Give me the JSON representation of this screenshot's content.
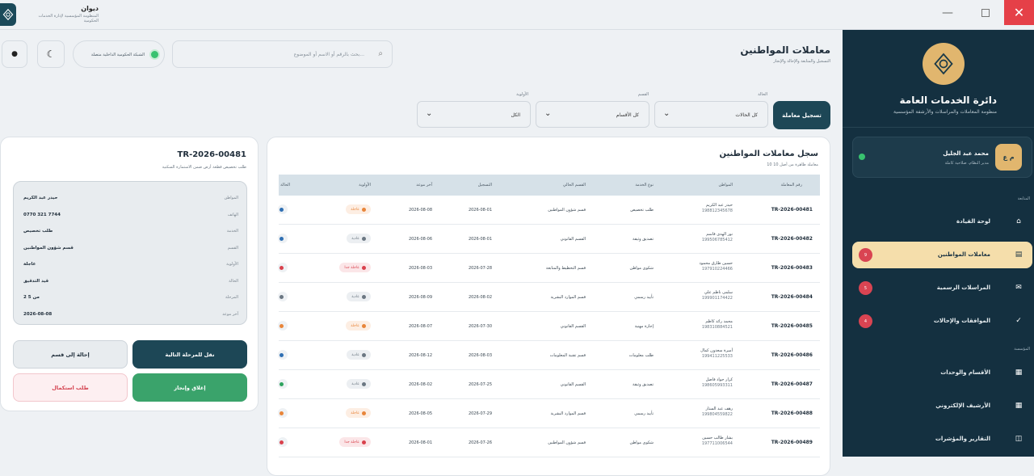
{
  "app": {
    "name": "ديوان",
    "subtitle": "المنظومة المؤسسية لإدارة الخدمات الحكومية"
  },
  "window": {
    "minimize": "—",
    "close": "✕"
  },
  "sidebar": {
    "org_title": "دائرة الخدمات العامة",
    "org_subtitle": "منظومة المعاملات والمراسلات والأرشفة المؤسسية",
    "user": {
      "initials": "م ع",
      "name": "محمد عبد الجليل",
      "role": "مدير النظام، صلاحية كاملة"
    },
    "section_main": "المتابعة",
    "section_admin": "المؤسسة",
    "items": [
      {
        "label": "لوحة القيادة",
        "icon": "home-icon",
        "glyph": "⌂"
      },
      {
        "label": "معاملات المواطنين",
        "icon": "list-icon",
        "glyph": "▤",
        "badge": "9",
        "active": true
      },
      {
        "label": "المراسلات الرسمية",
        "icon": "mail-icon",
        "glyph": "✉",
        "badge": "5"
      },
      {
        "label": "الموافقات والإحالات",
        "icon": "check-icon",
        "glyph": "✓",
        "badge": "4"
      },
      {
        "label": "الأقسام والوحدات",
        "icon": "grid-icon",
        "glyph": "▦"
      },
      {
        "label": "الأرشيف الإلكتروني",
        "icon": "archive-icon",
        "glyph": "▦"
      },
      {
        "label": "التقارير والمؤشرات",
        "icon": "report-icon",
        "glyph": "◫"
      }
    ]
  },
  "header": {
    "title": "معاملات المواطنين",
    "subtitle": "التسجيل والمتابعة والإحالة والإنجاز",
    "search_placeholder": "بحث بالرقم أو الاسم أو الموضوع...",
    "network": "الشبكة الحكومية الداخلية متصلة"
  },
  "filters": {
    "status_label": "الحالة",
    "status_value": "كل الحالات",
    "dept_label": "القسم",
    "dept_value": "كل الأقسام",
    "priority_label": "الأولوية",
    "priority_value": "الكل",
    "register_button": "تسجيل معاملة"
  },
  "list": {
    "title": "سجل معاملات المواطنين",
    "count": "10 معاملة ظاهرة من أصل 10",
    "columns": [
      "رقم المعاملة",
      "المواطن",
      "نوع الخدمة",
      "القسم الحالي",
      "التسجيل",
      "آخر موعد",
      "الأولوية",
      "الحالة"
    ],
    "rows": [
      {
        "id": "TR-2026-00481",
        "name": "حيدر عبد الكريم",
        "phone": "198812345678",
        "service": "طلب تخصيص",
        "dept": "قسم شؤون المواطنين",
        "reg": "2026-08-01",
        "due": "2026-08-08",
        "priority": "عاجلة",
        "pcolor": "#e8853a",
        "pbg": "#fdeee3",
        "scolor": "#2f6fb3"
      },
      {
        "id": "TR-2026-00482",
        "name": "نور الهدى قاسم",
        "phone": "199506785412",
        "service": "تصديق وثيقة",
        "dept": "القسم القانوني",
        "reg": "2026-08-01",
        "due": "2026-08-06",
        "priority": "عادية",
        "pcolor": "#6b7782",
        "pbg": "#eceff2",
        "scolor": "#2f6fb3"
      },
      {
        "id": "TR-2026-00483",
        "name": "حسين طارق محمود",
        "phone": "197910224466",
        "service": "شكوى مواطن",
        "dept": "قسم التخطيط والمتابعة",
        "reg": "2026-07-28",
        "due": "2026-08-03",
        "priority": "عاجلة جدا",
        "pcolor": "#d9414c",
        "pbg": "#fbe6e8",
        "scolor": "#d9414c"
      },
      {
        "id": "TR-2026-00484",
        "name": "سلمى ناظم علي",
        "phone": "199901174422",
        "service": "تأييد رسمي",
        "dept": "قسم الموارد البشرية",
        "reg": "2026-08-02",
        "due": "2026-08-09",
        "priority": "عادية",
        "pcolor": "#6b7782",
        "pbg": "#eceff2",
        "scolor": "#6b7782"
      },
      {
        "id": "TR-2026-00485",
        "name": "محمد رائد كاظم",
        "phone": "198310884521",
        "service": "إجازة مهنية",
        "dept": "القسم القانوني",
        "reg": "2026-07-30",
        "due": "2026-08-07",
        "priority": "عاجلة",
        "pcolor": "#e8853a",
        "pbg": "#fdeee3",
        "scolor": "#e8853a"
      },
      {
        "id": "TR-2026-00486",
        "name": "أميرة سعدون كمال",
        "phone": "199411225533",
        "service": "طلب معلومات",
        "dept": "قسم تقنية المعلومات",
        "reg": "2026-08-03",
        "due": "2026-08-12",
        "priority": "عادية",
        "pcolor": "#6b7782",
        "pbg": "#eceff2",
        "scolor": "#2f6fb3"
      },
      {
        "id": "TR-2026-00487",
        "name": "كرار جواد فاضل",
        "phone": "198605993311",
        "service": "تصديق وثيقة",
        "dept": "القسم القانوني",
        "reg": "2026-07-25",
        "due": "2026-08-02",
        "priority": "عادية",
        "pcolor": "#6b7782",
        "pbg": "#eceff2",
        "scolor": "#2fa35e"
      },
      {
        "id": "TR-2026-00488",
        "name": "رهف عبد الستار",
        "phone": "199804559822",
        "service": "تأييد رسمي",
        "dept": "قسم الموارد البشرية",
        "reg": "2026-07-29",
        "due": "2026-08-05",
        "priority": "عاجلة",
        "pcolor": "#e8853a",
        "pbg": "#fdeee3",
        "scolor": "#e8853a"
      },
      {
        "id": "TR-2026-00489",
        "name": "بشار طالب حسين",
        "phone": "197711006544",
        "service": "شكوى مواطن",
        "dept": "قسم شؤون المواطنين",
        "reg": "2026-07-26",
        "due": "2026-08-01",
        "priority": "عاجلة جدا",
        "pcolor": "#d9414c",
        "pbg": "#fbe6e8",
        "scolor": "#d9414c"
      }
    ]
  },
  "detail": {
    "id": "TR-2026-00481",
    "subject": "طلب تخصيص قطعة أرض ضمن الاستمارة السكنية",
    "fields": [
      {
        "k": "المواطن",
        "v": "حيدر عبد الكريم"
      },
      {
        "k": "الهاتف",
        "v": "0770 321 7744"
      },
      {
        "k": "الخدمة",
        "v": "طلب تخصيص"
      },
      {
        "k": "القسم",
        "v": "قسم شؤون المواطنين"
      },
      {
        "k": "الأولوية",
        "v": "عاجلة"
      },
      {
        "k": "الحالة",
        "v": "قيد التدقيق"
      },
      {
        "k": "المرحلة",
        "v": "2 من 5"
      },
      {
        "k": "آخر موعد",
        "v": "2026-08-08"
      }
    ],
    "next_button": "نقل للمرحلة التالية",
    "refer_button": "إحالة إلى قسم",
    "close_button": "إغلاق وإنجاز",
    "request_button": "طلب استكمال"
  },
  "colors": {
    "primary": "#143040",
    "accent": "#e1b66e",
    "success": "#38c26f",
    "danger": "#d94452"
  }
}
